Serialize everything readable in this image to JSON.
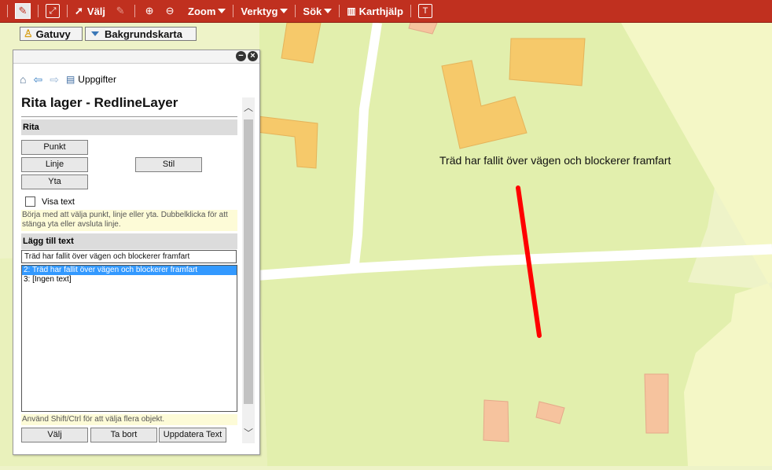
{
  "toolbar": {
    "valj_label": "Välj",
    "zoom_label": "Zoom",
    "verktyg_label": "Verktyg",
    "sok_label": "Sök",
    "karthjalp_label": "Karthjälp",
    "t_label": "T"
  },
  "map_buttons": {
    "gatuvy": "Gatuvy",
    "bakgrundskarta": "Bakgrundskarta"
  },
  "map": {
    "label_text": "Träd har fallit över vägen och blockerer framfart",
    "colors": {
      "field": "#eef3c8",
      "forest": "#e2efad",
      "building": "#f6c96a",
      "building_alt": "#f6c39e",
      "road": "#ffffff",
      "redline": "#ff0000"
    }
  },
  "panel": {
    "nav_uppgifter": "Uppgifter",
    "title": "Rita lager - RedlineLayer",
    "rita_section": "Rita",
    "punkt": "Punkt",
    "linje": "Linje",
    "yta": "Yta",
    "stil": "Stil",
    "visa_text": "Visa text",
    "hint_draw": "Börja med att välja punkt, linje eller yta. Dubbelklicka för att stänga yta eller avsluta linje.",
    "lagg_till_text_section": "Lägg till text",
    "text_input_value": "Träd har fallit över vägen och blockerer framfart",
    "list_items": [
      "2: Träd har fallit över vägen och blockerer framfart",
      "3: [Ingen text]"
    ],
    "hint_select": "Använd Shift/Ctrl för att välja flera objekt.",
    "valj_btn": "Välj",
    "ta_bort_btn": "Ta bort",
    "uppdatera_btn": "Uppdatera Text"
  }
}
